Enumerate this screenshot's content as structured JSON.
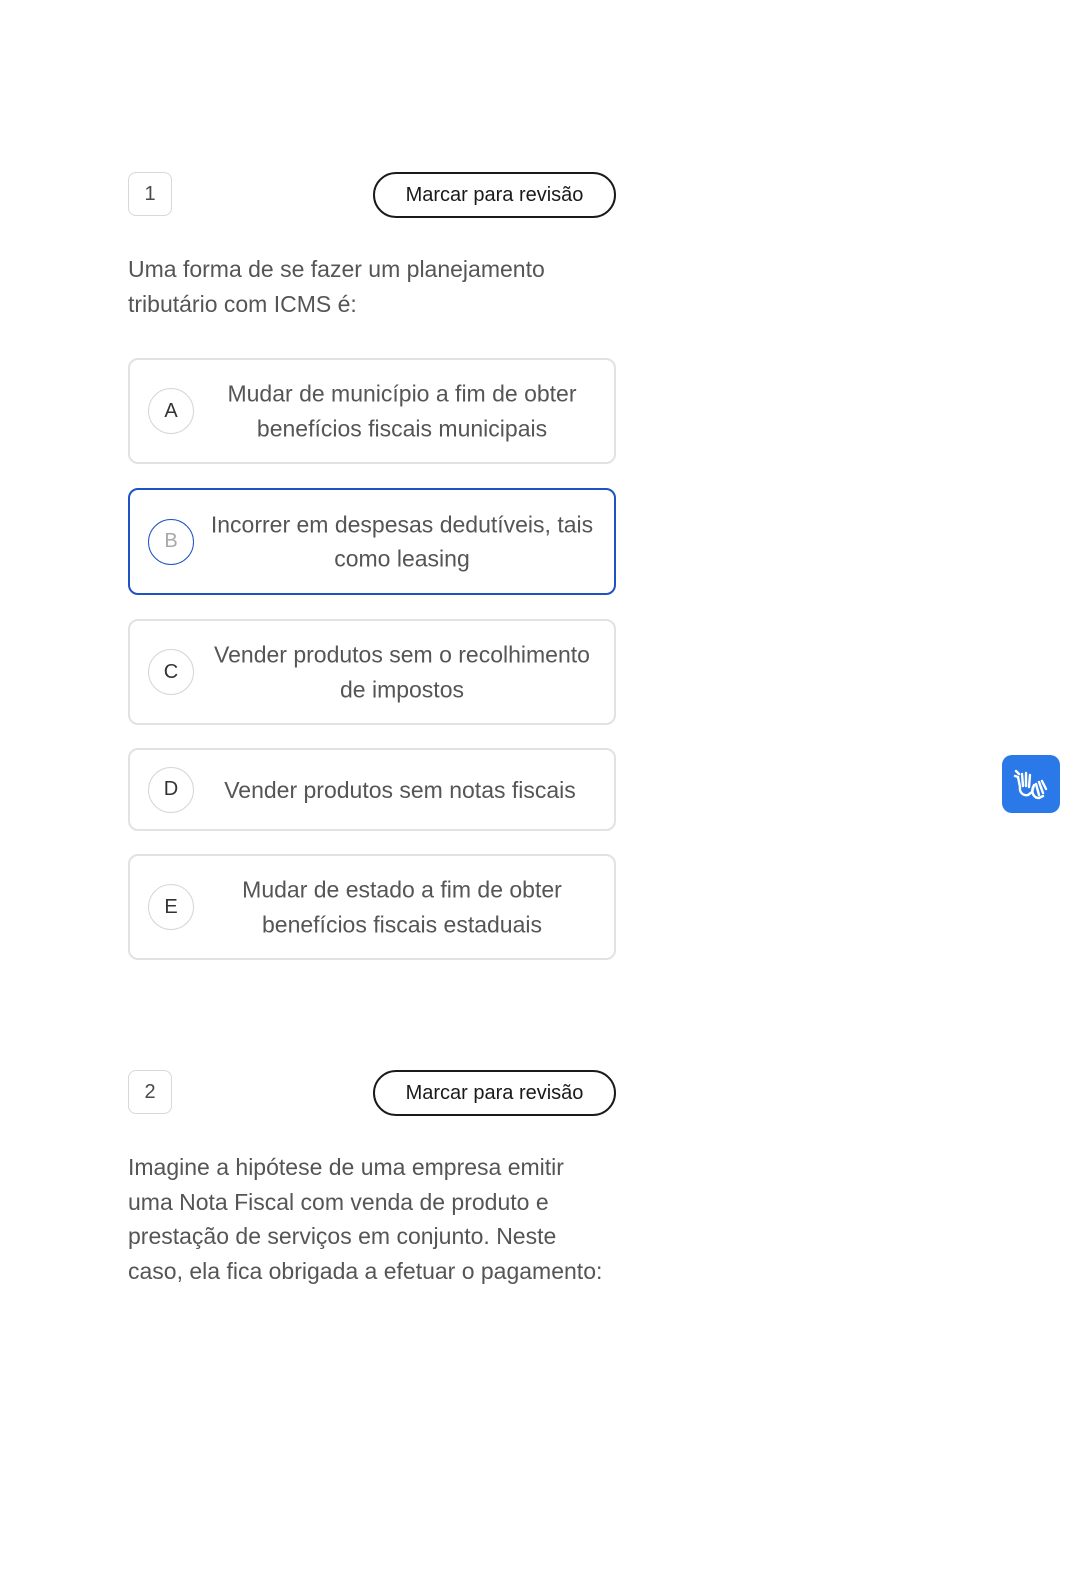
{
  "questions": [
    {
      "number": "1",
      "review_label": "Marcar para revisão",
      "text": "Uma forma de se fazer um planejamento tributário com ICMS é:",
      "options": [
        {
          "letter": "A",
          "text": "Mudar de município a fim de obter benefícios fiscais municipais",
          "selected": false
        },
        {
          "letter": "B",
          "text": "Incorrer em despesas dedutíveis, tais como leasing",
          "selected": true
        },
        {
          "letter": "C",
          "text": "Vender produtos sem o recolhimento de impostos",
          "selected": false
        },
        {
          "letter": "D",
          "text": "Vender produtos sem notas fiscais",
          "selected": false
        },
        {
          "letter": "E",
          "text": "Mudar de estado a fim de obter benefícios fiscais estaduais",
          "selected": false
        }
      ]
    },
    {
      "number": "2",
      "review_label": "Marcar para revisão",
      "text": "Imagine a hipótese de uma empresa emitir uma Nota Fiscal com venda de produto e prestação de serviços em conjunto. Neste caso, ela fica obrigada a efetuar o pagamento:"
    }
  ],
  "accessibility_widget": {
    "icon": "sign-language-hands-icon",
    "color": "#2b79e8"
  },
  "colors": {
    "selected_border": "#1f53c5",
    "option_border": "#e2e2e2",
    "text": "#555555"
  }
}
